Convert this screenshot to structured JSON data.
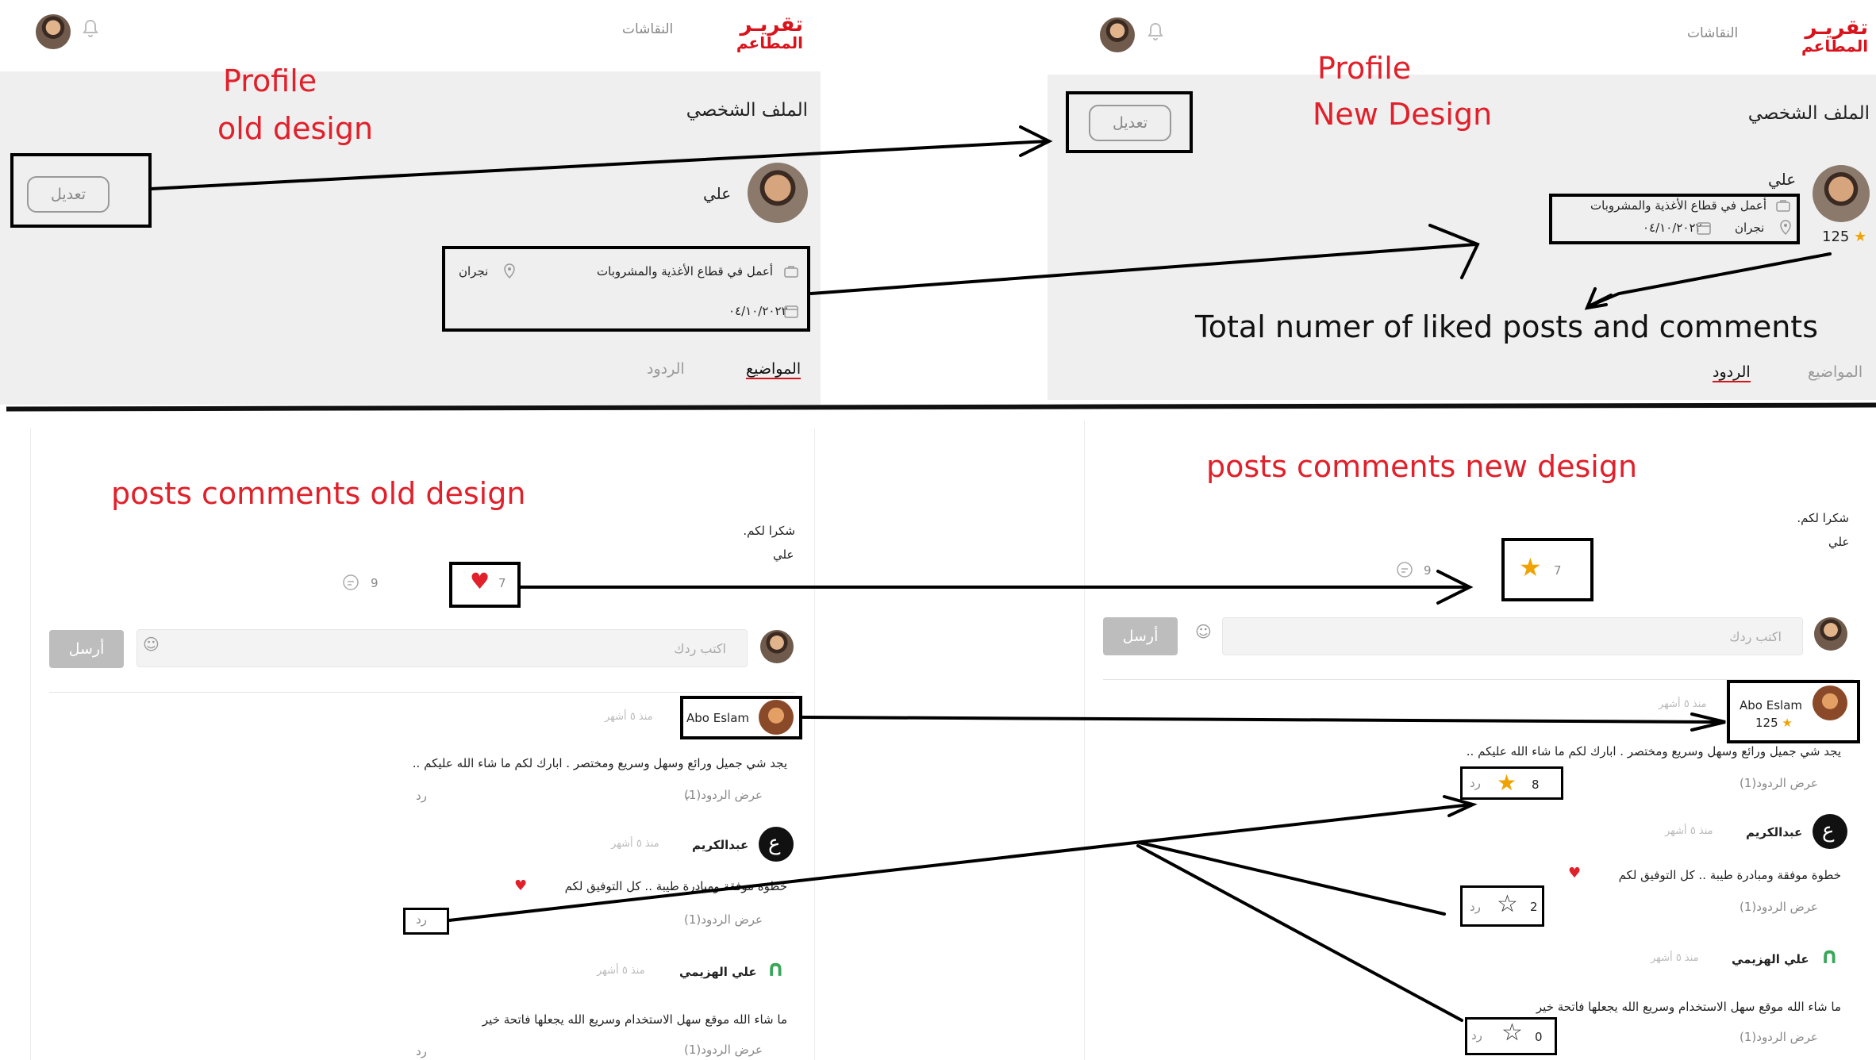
{
  "logo": {
    "line1": "تقريـر",
    "line2": "المطاعم"
  },
  "nav": {
    "discussions": "النقاشات"
  },
  "annotations": {
    "profile_old_line1": "Profile",
    "profile_old_line2": "old design",
    "profile_new_line1": "Profile",
    "profile_new_line2": "New Design",
    "total_liked": "Total numer of liked posts and comments",
    "posts_old": "posts comments old design",
    "posts_new": "posts comments new design"
  },
  "profile": {
    "heading": "الملف الشخصي",
    "edit_label": "تعديل",
    "name": "علي",
    "work": "أعمل في قطاع الأغذية والمشروبات",
    "location": "نجران",
    "date": "٠٤/١٠/٢٠٢٢",
    "likes_total": "125"
  },
  "tabs": {
    "topics": "المواضيع",
    "replies": "الردود"
  },
  "post": {
    "text": "شكرا لكم.",
    "author": "علي",
    "comments_count": "9",
    "likes_count": "7"
  },
  "composer": {
    "placeholder": "اكتب ردك",
    "send_label": "أرسل"
  },
  "comments": [
    {
      "author": "Abo Eslam",
      "author_likes": "125",
      "time": "منذ ٥ أشهر",
      "text": "يجد شي جميل ورائع وسهل وسريع ومختصر . ابارك لكم ما شاء الله عليكم ..",
      "show_replies": "عرض الردود(1)",
      "reply": "رد",
      "likes": "8"
    },
    {
      "author": "عبدالكريم",
      "time": "منذ ٥ أشهر",
      "text": "خطوة موفقة ومبادرة طيبة .. كل التوفيق لكم",
      "show_replies": "عرض الردود(1)",
      "reply": "رد",
      "likes": "2"
    },
    {
      "author": "علي الهزيمي",
      "time": "منذ ٥ أشهر",
      "text": "ما شاء الله موقع سهل الاستخدام وسريع الله يجعلها فاتحة خير",
      "show_replies": "عرض الردود(1)",
      "reply": "رد",
      "likes": "0"
    }
  ],
  "colors": {
    "brand": "#d9131c",
    "star": "#f0a300",
    "heart": "#e0202a"
  }
}
